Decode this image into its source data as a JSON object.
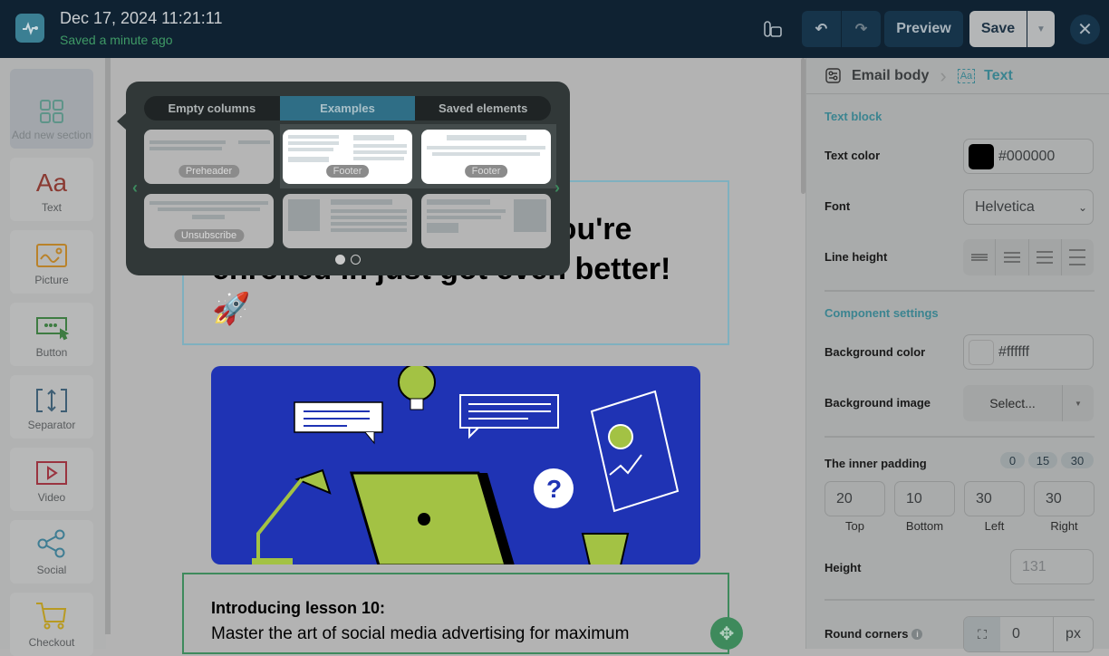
{
  "header": {
    "title": "Dec 17, 2024 11:21:11",
    "status": "Saved a minute ago",
    "preview": "Preview",
    "save": "Save"
  },
  "sidebar": {
    "items": [
      {
        "label": "Add new section",
        "icon": "grid-icon"
      },
      {
        "label": "Text",
        "icon": "text-aa-icon"
      },
      {
        "label": "Picture",
        "icon": "picture-icon"
      },
      {
        "label": "Button",
        "icon": "button-icon"
      },
      {
        "label": "Separator",
        "icon": "separator-icon"
      },
      {
        "label": "Video",
        "icon": "video-icon"
      },
      {
        "label": "Social",
        "icon": "share-icon"
      },
      {
        "label": "Checkout",
        "icon": "cart-icon"
      }
    ]
  },
  "popup": {
    "tabs": [
      "Empty columns",
      "Examples",
      "Saved elements"
    ],
    "active_tab": 1,
    "cards": [
      "Preheader",
      "Footer",
      "Footer",
      "Unsubscribe",
      "",
      ""
    ],
    "page": 1,
    "pages": 2
  },
  "canvas": {
    "heading": "The marketing course you're enrolled in just got even better! 🚀",
    "lesson_title": "Introducing lesson 10:",
    "lesson_text": "Master the art of social media advertising for maximum"
  },
  "panel": {
    "crumb_parent": "Email body",
    "crumb_current": "Text",
    "text_block": "Text block",
    "text_color_label": "Text color",
    "text_color": "#000000",
    "font_label": "Font",
    "font": "Helvetica",
    "line_height_label": "Line height",
    "component_settings": "Component settings",
    "bg_color_label": "Background color",
    "bg_color": "#ffffff",
    "bg_image_label": "Background image",
    "bg_image": "Select...",
    "padding_label": "The inner padding",
    "padding_presets": [
      "0",
      "15",
      "30"
    ],
    "padding": [
      {
        "label": "Top",
        "value": "20"
      },
      {
        "label": "Bottom",
        "value": "10"
      },
      {
        "label": "Left",
        "value": "30"
      },
      {
        "label": "Right",
        "value": "30"
      }
    ],
    "height_label": "Height",
    "height": "131",
    "round_label": "Round corners",
    "round": "0",
    "round_unit": "px"
  }
}
